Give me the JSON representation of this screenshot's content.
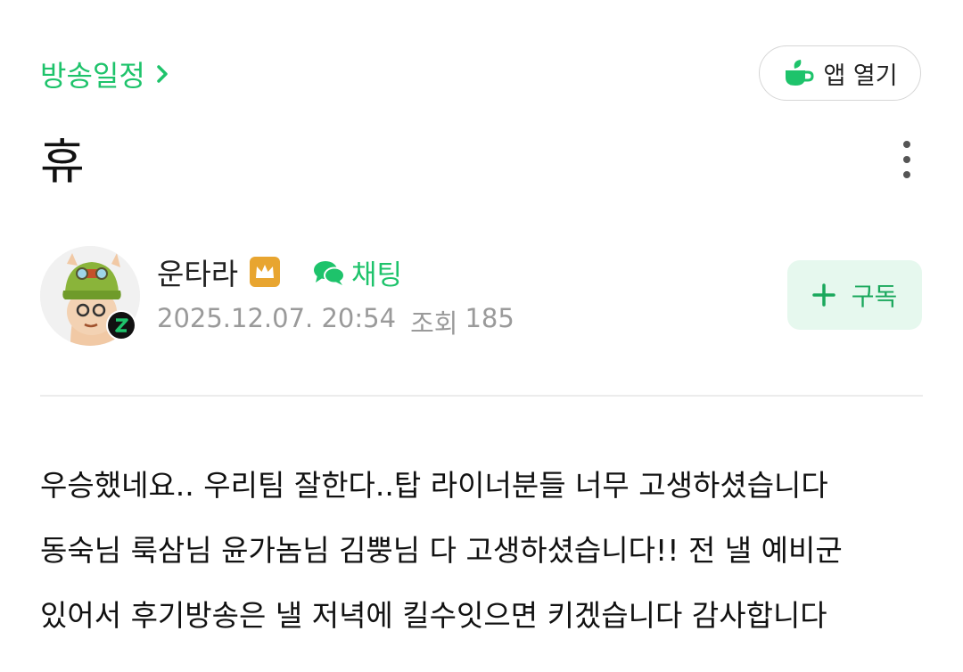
{
  "header": {
    "schedule_link": "방송일정",
    "app_open_label": "앱 열기"
  },
  "post": {
    "title": "휴",
    "author": "운타라",
    "chat_label": "채팅",
    "date": "2025.12.07. 20:54",
    "views_label": "조회",
    "views": "185",
    "subscribe_label": "구독",
    "body_lines": [
      "우승했네요.. 우리팀 잘한다..탑 라이너분들 너무 고생하셨습니다",
      "동숙님 룩삼님 윤가놈님 김뿡님 다 고생하셨습니다!! 전 낼 예비군",
      "있어서 후기방송은 낼 저녁에 킬수잇으면 키겠습니다  감사합니다"
    ]
  },
  "colors": {
    "accent": "#1ec36b",
    "subscribe_bg": "#e6f8ee",
    "crown": "#e8a530",
    "meta_text": "#9a9a9a"
  },
  "icons": {
    "app": "cup-leaf-icon",
    "more": "more-vertical-icon",
    "crown": "crown-icon",
    "chat": "chat-bubbles-icon",
    "plus": "plus-icon",
    "chevron": "chevron-right-icon"
  }
}
